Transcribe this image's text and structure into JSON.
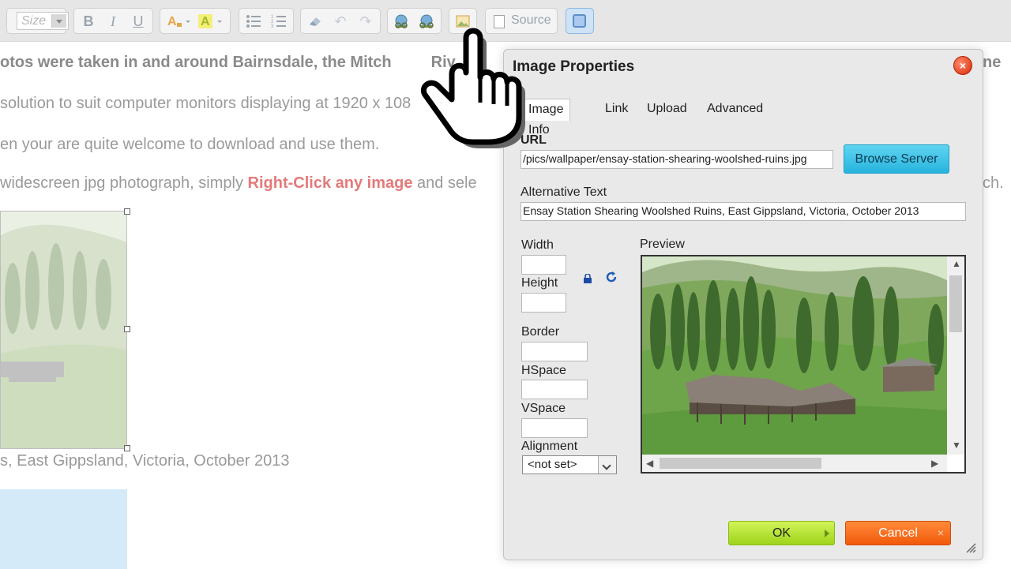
{
  "toolbar": {
    "size_placeholder": "Size",
    "source_label": "Source",
    "buttons": [
      "bold",
      "italic",
      "underline",
      "text-color",
      "background-color",
      "bulleted-list",
      "numbered-list",
      "remove-format",
      "undo",
      "redo",
      "link",
      "unlink",
      "image",
      "source",
      "maximize"
    ]
  },
  "page": {
    "line1_prefix": "otos were taken in and around Bairnsdale, the Mitch",
    "line1_mid": "Riv",
    "line1_suffix": "ne",
    "line2": "solution to suit computer monitors displaying at 1920 x 108",
    "line3": "en your are quite welcome to download and use them.",
    "line4_prefix": "widescreen jpg photograph, simply ",
    "line4_highlight": "Right-Click any image",
    "line4_suffix": " and sele",
    "line4_end": "ch.",
    "caption": "s, East Gippsland, Victoria, October 2013"
  },
  "dialog": {
    "title": "Image Properties",
    "close_label": "×",
    "tabs": [
      {
        "label": "Image Info",
        "active": true
      },
      {
        "label": "Link",
        "active": false
      },
      {
        "label": "Upload",
        "active": false
      },
      {
        "label": "Advanced",
        "active": false
      }
    ],
    "url_label": "URL",
    "url_value": "/pics/wallpaper/ensay-station-shearing-woolshed-ruins.jpg",
    "browse_label": "Browse Server",
    "alt_label": "Alternative Text",
    "alt_value": "Ensay Station Shearing Woolshed Ruins, East Gippsland, Victoria, October 2013",
    "width_label": "Width",
    "width_value": "",
    "height_label": "Height",
    "height_value": "",
    "border_label": "Border",
    "border_value": "",
    "hspace_label": "HSpace",
    "hspace_value": "",
    "vspace_label": "VSpace",
    "vspace_value": "",
    "alignment_label": "Alignment",
    "alignment_value": "<not set>",
    "preview_label": "Preview",
    "ok_label": "OK",
    "cancel_label": "Cancel",
    "cancel_icon": "×"
  },
  "colors": {
    "ok_button": "#b7e33a",
    "cancel_button": "#f36a1c",
    "browse_button": "#3cc3e8",
    "highlight_text": "#e47a7a"
  }
}
